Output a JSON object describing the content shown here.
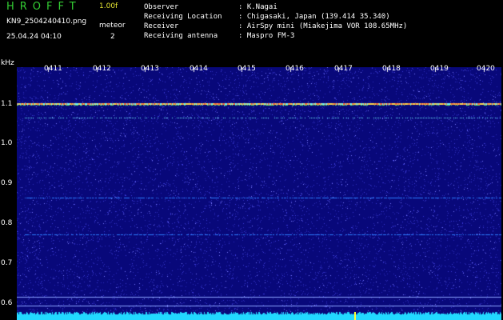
{
  "header": {
    "app_title": "HROFFT",
    "version": "1.00f",
    "filename": "KN9_2504240410.png",
    "meteor_label": "meteor",
    "meteor_count": "2",
    "timestamp": "25.04.24 04:10"
  },
  "info": [
    {
      "label": "Observer",
      "value": ": K.Nagai"
    },
    {
      "label": "Receiving Location",
      "value": ": Chigasaki, Japan (139.414 35.340)"
    },
    {
      "label": "Receiver",
      "value": ": AirSpy mini (Miakejima VOR 108.65MHz)"
    },
    {
      "label": "Receiving antenna",
      "value": ": Maspro FM-3"
    }
  ],
  "spectrogram": {
    "y_unit": "kHz",
    "y_ticks": [
      "1.1",
      "1.0",
      "0.9",
      "0.8",
      "0.7",
      "0.6"
    ],
    "x_ticks": [
      "0411",
      "0412",
      "0413",
      "0414",
      "0415",
      "0416",
      "0417",
      "0418",
      "0419",
      "0420"
    ],
    "colors": {
      "background": "#08087a",
      "noise": "#3a3ad8",
      "signal_strong": "#ffd84a",
      "signal_mid": "#6cf0ff",
      "signal_weak": "#2b7cff",
      "floor": "#22d8ff"
    }
  }
}
